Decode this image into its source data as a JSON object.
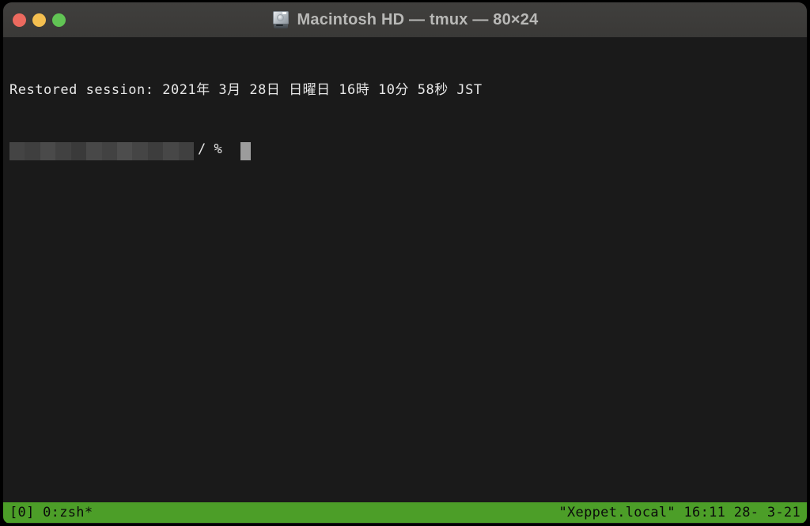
{
  "window": {
    "title": "Macintosh HD — tmux — 80×24",
    "title_icon": "hard-drive-icon",
    "traffic_lights": [
      {
        "name": "close",
        "color": "#ec6a5f"
      },
      {
        "name": "minimize",
        "color": "#f4bf50"
      },
      {
        "name": "zoom",
        "color": "#61c454"
      }
    ],
    "titlebar_color": "#3c3b39"
  },
  "terminal": {
    "background": "#1a1a1a",
    "foreground": "#e8e8e8",
    "lines": [
      "Restored session: 2021年 3月 28日 日曜日 16時 10分 58秒 JST"
    ],
    "prompt_tail": "/ %",
    "redaction_blocks": [
      "#444444",
      "#3f3f3f",
      "#4a4a4a",
      "#414141",
      "#3a3a3a",
      "#484848",
      "#424242",
      "#4d4d4d",
      "#454545",
      "#3d3d3d",
      "#474747",
      "#404040"
    ],
    "cursor_color": "#9c9c9c"
  },
  "status_bar": {
    "background": "#4c9e28",
    "foreground": "#0b0b0b",
    "left": "[0] 0:zsh*",
    "right": "\"Xeppet.local\" 16:11 28- 3-21"
  }
}
